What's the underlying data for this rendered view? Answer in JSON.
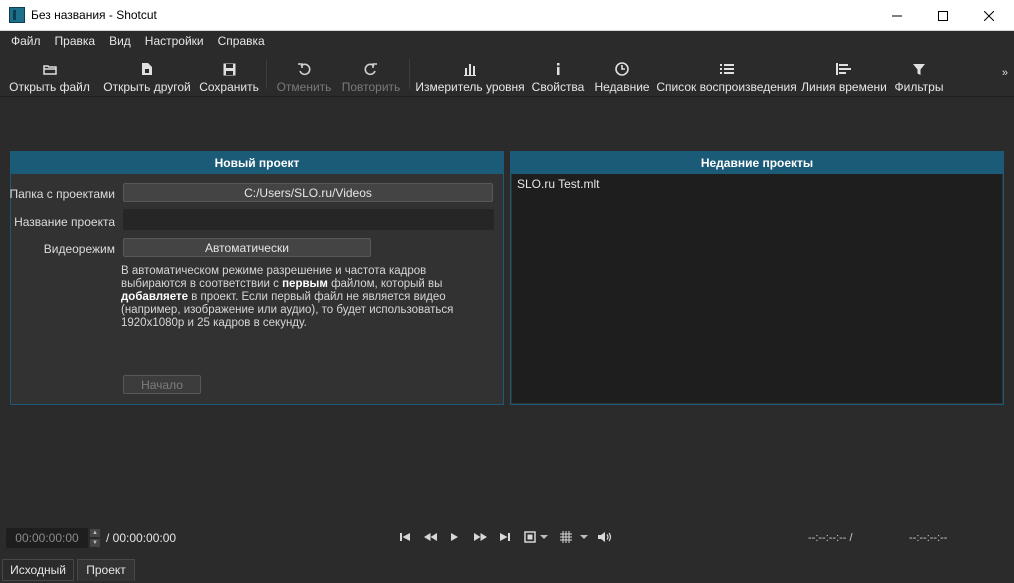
{
  "window": {
    "title": "Без названия - Shotcut"
  },
  "menu": [
    "Файл",
    "Правка",
    "Вид",
    "Настройки",
    "Справка"
  ],
  "toolbar": {
    "open_file": "Открыть файл",
    "open_other": "Открыть другой",
    "save": "Сохранить",
    "undo": "Отменить",
    "redo": "Повторить",
    "meter": "Измеритель уровня",
    "properties": "Свойства",
    "recent": "Недавние",
    "playlist": "Список воспроизведения",
    "timeline": "Линия времени",
    "filters": "Фильтры",
    "more": "»"
  },
  "new_project": {
    "header": "Новый проект",
    "folder_label": "Папка с проектами",
    "folder_value": "C:/Users/SLO.ru/Videos",
    "name_label": "Название проекта",
    "name_value": "",
    "video_mode_label": "Видеорежим",
    "video_mode_value": "Автоматически",
    "desc_1": "В автоматическом режиме разрешение и частота кадров выбираются в соответствии с ",
    "desc_bold_1": "первым",
    "desc_2": " файлом, который вы ",
    "desc_bold_2": "добавляете",
    "desc_3": " в проект. Если первый файл не является видео (например, изображение или аудио), то будет использоваться 1920x1080p и 25 кадров в секунду.",
    "start_button": "Начало"
  },
  "recent_projects": {
    "header": "Недавние проекты",
    "items": [
      "SLO.ru Test.mlt"
    ]
  },
  "transport": {
    "position": "00:00:00:00",
    "duration": "/ 00:00:00:00",
    "in_point": "--:--:--:-- /",
    "out_point": "--:--:--:--"
  },
  "tabs": [
    "Исходный",
    "Проект"
  ],
  "colors": {
    "accent": "#1b5b78",
    "background": "#2b2b2b"
  }
}
